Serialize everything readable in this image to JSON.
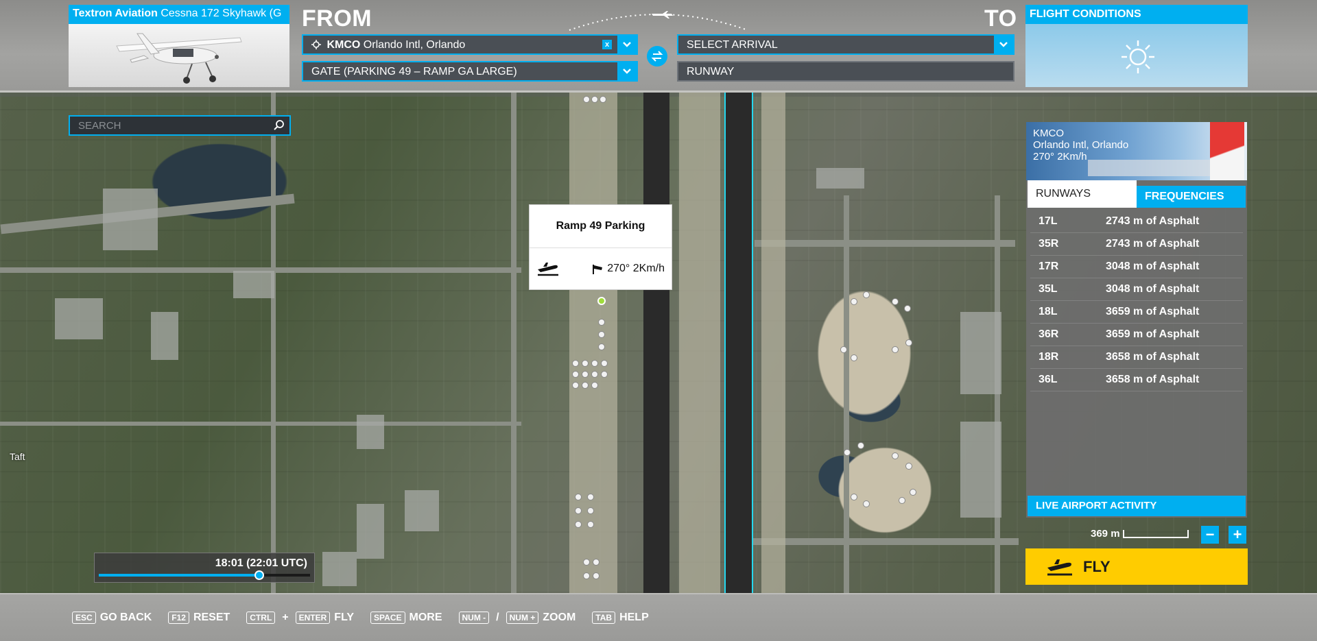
{
  "aircraft": {
    "brand": "Textron Aviation",
    "model": "Cessna 172 Skyhawk (G"
  },
  "route": {
    "from_label": "FROM",
    "to_label": "TO",
    "departure_code": "KMCO",
    "departure_name": "Orlando Intl, Orlando",
    "departure_clear_icon": "x",
    "departure_spot": "GATE (PARKING 49 – RAMP GA LARGE)",
    "arrival_placeholder": "SELECT ARRIVAL",
    "arrival_runway": "RUNWAY"
  },
  "conditions": {
    "title": "FLIGHT CONDITIONS",
    "icon": "sun-icon"
  },
  "search": {
    "placeholder": "SEARCH"
  },
  "popup": {
    "title": "Ramp 49 Parking",
    "wind": "270° 2Km/h"
  },
  "airport": {
    "code": "KMCO",
    "name": "Orlando Intl, Orlando",
    "wind": "270° 2Km/h",
    "tabs": [
      "RUNWAYS",
      "FREQUENCIES"
    ],
    "runways": [
      {
        "id": "17L",
        "info": "2743 m of Asphalt"
      },
      {
        "id": "35R",
        "info": "2743 m of Asphalt"
      },
      {
        "id": "17R",
        "info": "3048 m of Asphalt"
      },
      {
        "id": "35L",
        "info": "3048 m of Asphalt"
      },
      {
        "id": "18L",
        "info": "3659 m of Asphalt"
      },
      {
        "id": "36R",
        "info": "3659 m of Asphalt"
      },
      {
        "id": "18R",
        "info": "3658 m of Asphalt"
      },
      {
        "id": "36L",
        "info": "3658 m of Asphalt"
      }
    ],
    "live_activity": "LIVE AIRPORT ACTIVITY"
  },
  "map": {
    "place_label": "Taft",
    "scale": "369 m",
    "zoom_out": "−",
    "zoom_in": "+"
  },
  "time": {
    "label": "18:01 (22:01 UTC)",
    "progress": 0.76
  },
  "fly_label": "FLY",
  "shortcuts": [
    {
      "keys": [
        "ESC"
      ],
      "label": "GO BACK"
    },
    {
      "keys": [
        "F12"
      ],
      "label": "RESET"
    },
    {
      "keys": [
        "CTRL",
        "ENTER"
      ],
      "sep": "+",
      "label": "FLY"
    },
    {
      "keys": [
        "SPACE"
      ],
      "label": "MORE"
    },
    {
      "keys": [
        "NUM -",
        "NUM +"
      ],
      "sep": "/",
      "label": "ZOOM"
    },
    {
      "keys": [
        "TAB"
      ],
      "label": "HELP"
    }
  ],
  "colors": {
    "accent": "#00aff0",
    "fly": "#ffcc00",
    "runway_highlight": "#25d8ef"
  }
}
